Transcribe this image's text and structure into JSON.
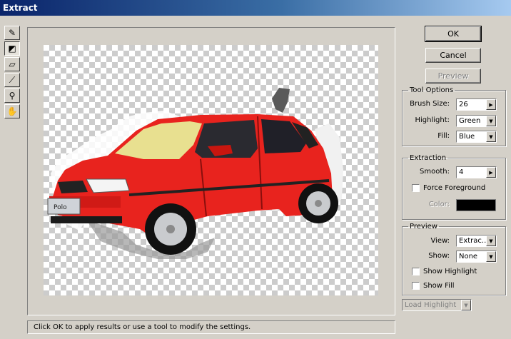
{
  "window": {
    "title": "Extract"
  },
  "toolbar": {
    "tools": [
      {
        "name": "edge-highlighter-tool",
        "glyph": "✎"
      },
      {
        "name": "fill-tool",
        "glyph": "◩"
      },
      {
        "name": "eraser-tool",
        "glyph": "▱"
      },
      {
        "name": "eyedropper-tool",
        "glyph": "⟋"
      },
      {
        "name": "zoom-tool",
        "glyph": "⚲"
      },
      {
        "name": "hand-tool",
        "glyph": "✋"
      }
    ]
  },
  "buttons": {
    "ok": "OK",
    "cancel": "Cancel",
    "preview": "Preview"
  },
  "tool_options": {
    "title": "Tool Options",
    "brush_size_label": "Brush Size:",
    "brush_size": "26",
    "highlight_label": "Highlight:",
    "highlight": "Green",
    "fill_label": "Fill:",
    "fill": "Blue"
  },
  "extraction": {
    "title": "Extraction",
    "smooth_label": "Smooth:",
    "smooth": "4",
    "force_foreground": "Force Foreground",
    "color_label": "Color:",
    "color_value": "#000000"
  },
  "preview": {
    "title": "Preview",
    "view_label": "View:",
    "view": "Extrac...",
    "show_label": "Show:",
    "show": "None",
    "show_highlight": "Show Highlight",
    "show_fill": "Show Fill"
  },
  "load_highlight": "Load Highlight",
  "status": "Click OK to apply results or use a tool to modify the settings.",
  "image": {
    "plate_text": "Polo",
    "car_color": "#e8231e"
  }
}
